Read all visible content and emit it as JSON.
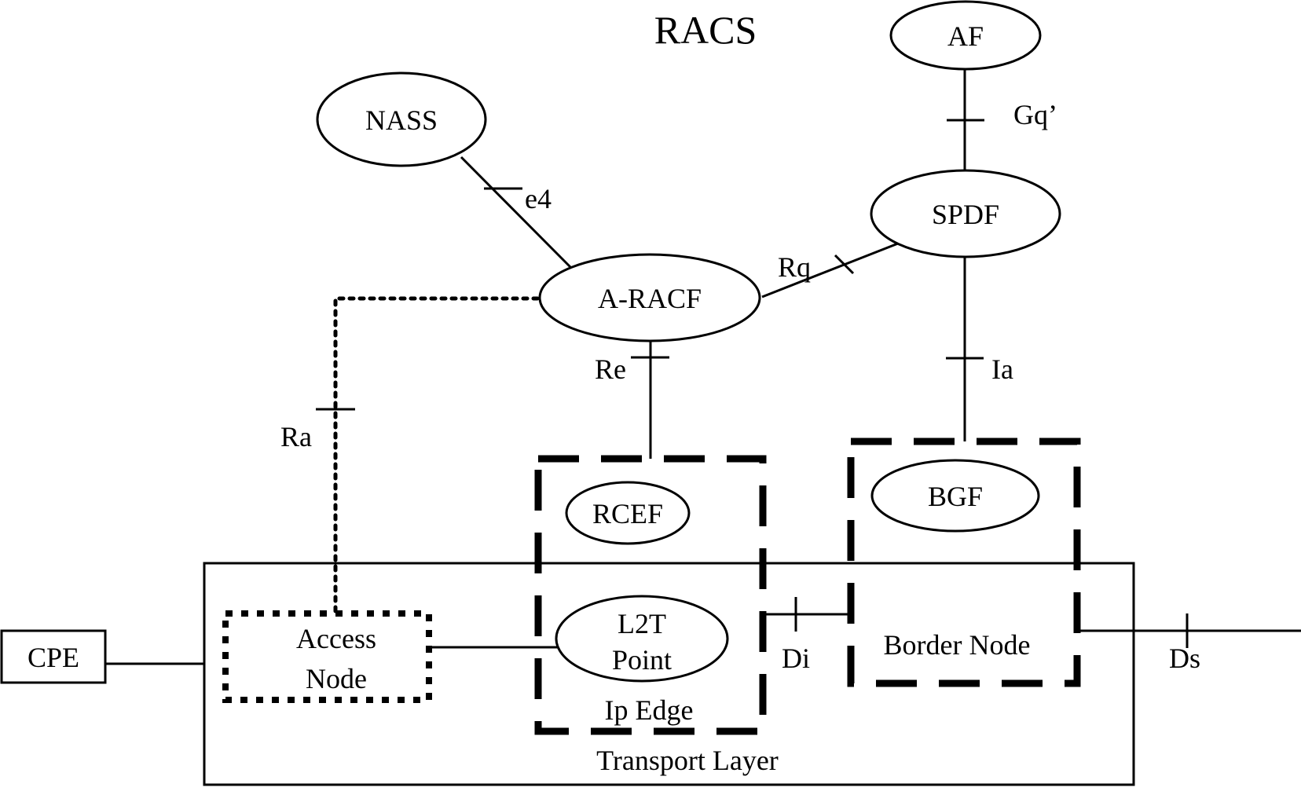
{
  "diagram": {
    "title": "RACS",
    "nodes": {
      "af": "AF",
      "nass": "NASS",
      "spdf": "SPDF",
      "a_racf": "A-RACF",
      "rcef": "RCEF",
      "bgf": "BGF",
      "l2t_line1": "L2T",
      "l2t_line2": "Point",
      "cpe": "CPE",
      "access_line1": "Access",
      "access_line2": "Node"
    },
    "groups": {
      "ip_edge": "Ip Edge",
      "border_node": "Border Node",
      "transport_layer": "Transport Layer"
    },
    "interfaces": {
      "gq": "Gq’",
      "e4": "e4",
      "rq": "Rq",
      "re": "Re",
      "ia": "Ia",
      "ra": "Ra",
      "di": "Di",
      "ds": "Ds"
    },
    "links": [
      {
        "from": "AF",
        "to": "SPDF",
        "interface": "Gq’",
        "style": "solid"
      },
      {
        "from": "NASS",
        "to": "A-RACF",
        "interface": "e4",
        "style": "solid"
      },
      {
        "from": "A-RACF",
        "to": "SPDF",
        "interface": "Rq",
        "style": "solid"
      },
      {
        "from": "A-RACF",
        "to": "Ip Edge",
        "interface": "Re",
        "style": "solid"
      },
      {
        "from": "SPDF",
        "to": "Border Node",
        "interface": "Ia",
        "style": "solid"
      },
      {
        "from": "A-RACF",
        "to": "Access Node",
        "interface": "Ra",
        "style": "dotted"
      },
      {
        "from": "Ip Edge",
        "to": "Border Node",
        "interface": "Di",
        "style": "solid"
      },
      {
        "from": "Border Node",
        "to": "external",
        "interface": "Ds",
        "style": "solid"
      },
      {
        "from": "CPE",
        "to": "Transport Layer",
        "interface": "",
        "style": "solid"
      },
      {
        "from": "Access Node",
        "to": "L2T Point",
        "interface": "",
        "style": "solid"
      }
    ]
  }
}
